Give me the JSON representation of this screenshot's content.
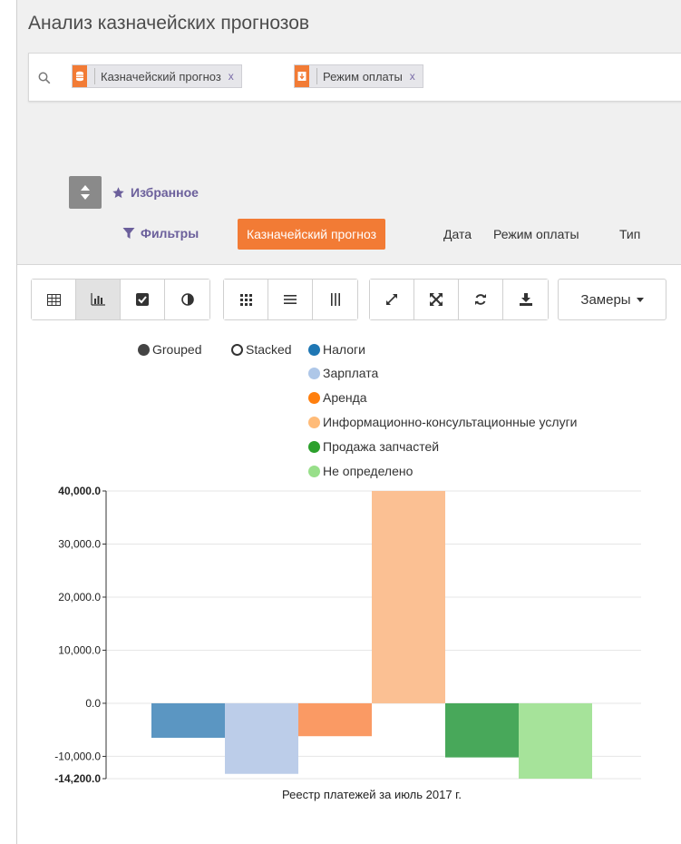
{
  "page": {
    "title": "Анализ казначейских прогнозов"
  },
  "search": {
    "icon": "search-icon",
    "facets": [
      {
        "label": "Казначейский прогноз",
        "icon": "database-icon",
        "color": "#f27b35"
      },
      {
        "label": "Режим оплаты",
        "icon": "download-icon",
        "color": "#f27b35"
      }
    ],
    "remove_symbol": "x"
  },
  "controls": {
    "favorites_label": "Избранное",
    "filters_label": "Фильтры",
    "groupby": [
      {
        "label": "Казначейский прогноз",
        "active": true
      },
      {
        "label": "Дата",
        "active": false
      },
      {
        "label": "Режим оплаты",
        "active": false
      },
      {
        "label": "Тип",
        "active": false
      }
    ]
  },
  "toolbar": {
    "view_buttons": [
      {
        "icon": "table-icon",
        "active": false
      },
      {
        "icon": "bar-chart-icon",
        "active": true
      },
      {
        "icon": "checkbox-icon",
        "active": false
      },
      {
        "icon": "contrast-icon",
        "active": false
      }
    ],
    "layout_buttons": [
      {
        "icon": "grid-icon"
      },
      {
        "icon": "rows-icon"
      },
      {
        "icon": "columns-icon"
      }
    ],
    "action_buttons": [
      {
        "icon": "expand-icon"
      },
      {
        "icon": "flip-axis-icon"
      },
      {
        "icon": "refresh-icon"
      },
      {
        "icon": "download-icon"
      }
    ],
    "measures_label": "Замеры"
  },
  "chart_data": {
    "type": "bar",
    "modes": [
      {
        "label": "Grouped",
        "selected": true
      },
      {
        "label": "Stacked",
        "selected": false
      }
    ],
    "categories": [
      "Реестр платежей за июль 2017 г."
    ],
    "series": [
      {
        "name": "Налоги",
        "color": "#5b96c2",
        "values": [
          -6500
        ]
      },
      {
        "name": "Зарплата",
        "color": "#bccde9",
        "values": [
          -13300
        ]
      },
      {
        "name": "Аренда",
        "color": "#fa9a64",
        "values": [
          -6200
        ]
      },
      {
        "name": "Информационно-консультационные услуги",
        "color": "#fbc093",
        "values": [
          40000
        ]
      },
      {
        "name": "Продажа запчастей",
        "color": "#48a85a",
        "values": [
          -10200
        ]
      },
      {
        "name": "Не определено",
        "color": "#a6e39a",
        "values": [
          -14200
        ]
      }
    ],
    "ylim": [
      -14200,
      40000
    ],
    "yticks": [
      "40,000.0",
      "30,000.0",
      "20,000.0",
      "10,000.0",
      "0.0",
      "-10,000.0",
      "-14,200.0"
    ],
    "ytick_values": [
      40000,
      30000,
      20000,
      10000,
      0,
      -10000,
      -14200
    ],
    "legend": "top",
    "grid": true
  }
}
